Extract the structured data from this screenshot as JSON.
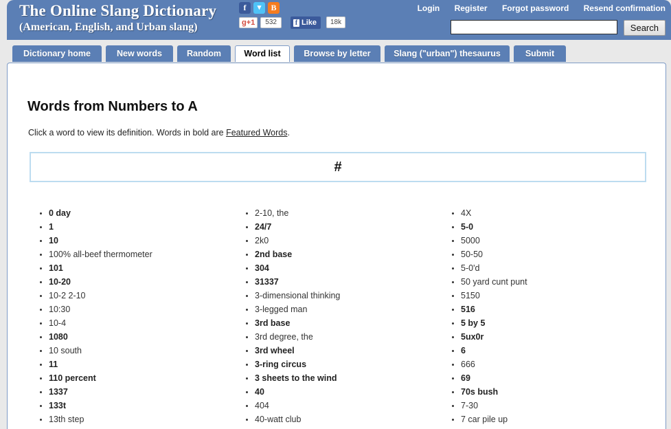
{
  "header": {
    "title_line1": "The Online Slang Dictionary",
    "title_line2": "(American, English, and Urban slang)",
    "social": {
      "facebook_icon": "f",
      "twitter_icon": "▾",
      "blogger_icon": "B",
      "gplus_label": "g+1",
      "gplus_count": "532",
      "fb_like_label": "Like",
      "fb_like_count": "18k"
    },
    "account_links": [
      {
        "label": "Login"
      },
      {
        "label": "Register"
      },
      {
        "label": "Forgot password"
      },
      {
        "label": "Resend confirmation"
      }
    ],
    "search": {
      "value": "",
      "placeholder": "",
      "button_label": "Search"
    }
  },
  "tabs": [
    {
      "label": "Dictionary home",
      "active": false
    },
    {
      "label": "New words",
      "active": false
    },
    {
      "label": "Random",
      "active": false
    },
    {
      "label": "Word list",
      "active": true
    },
    {
      "label": "Browse by letter",
      "active": false
    },
    {
      "label": "Slang (\"urban\") thesaurus",
      "active": false
    },
    {
      "label": "Submit",
      "active": false
    }
  ],
  "main": {
    "page_title": "Words from Numbers to A",
    "subtitle_prefix": "Click a word to view its definition. Words in bold are ",
    "subtitle_link": "Featured Words",
    "subtitle_suffix": ".",
    "letter_heading": "#",
    "columns": [
      {
        "items": [
          {
            "label": "0 day",
            "featured": true
          },
          {
            "label": "1",
            "featured": true
          },
          {
            "label": "10",
            "featured": true
          },
          {
            "label": "100% all-beef thermometer",
            "featured": false
          },
          {
            "label": "101",
            "featured": true
          },
          {
            "label": "10-20",
            "featured": true
          },
          {
            "label": "10-2 2-10",
            "featured": false
          },
          {
            "label": "10:30",
            "featured": false
          },
          {
            "label": "10-4",
            "featured": false
          },
          {
            "label": "1080",
            "featured": true
          },
          {
            "label": "10 south",
            "featured": false
          },
          {
            "label": "11",
            "featured": true
          },
          {
            "label": "110 percent",
            "featured": true
          },
          {
            "label": "1337",
            "featured": true
          },
          {
            "label": "133t",
            "featured": true
          },
          {
            "label": "13th step",
            "featured": false
          }
        ]
      },
      {
        "items": [
          {
            "label": "2-10, the",
            "featured": false
          },
          {
            "label": "24/7",
            "featured": true
          },
          {
            "label": "2k0",
            "featured": false
          },
          {
            "label": "2nd base",
            "featured": true
          },
          {
            "label": "304",
            "featured": true
          },
          {
            "label": "31337",
            "featured": true
          },
          {
            "label": "3-dimensional thinking",
            "featured": false
          },
          {
            "label": "3-legged man",
            "featured": false
          },
          {
            "label": "3rd base",
            "featured": true
          },
          {
            "label": "3rd degree, the",
            "featured": false
          },
          {
            "label": "3rd wheel",
            "featured": true
          },
          {
            "label": "3-ring circus",
            "featured": true
          },
          {
            "label": "3 sheets to the wind",
            "featured": true
          },
          {
            "label": "40",
            "featured": true
          },
          {
            "label": "404",
            "featured": false
          },
          {
            "label": "40-watt club",
            "featured": false
          }
        ]
      },
      {
        "items": [
          {
            "label": "4X",
            "featured": false
          },
          {
            "label": "5-0",
            "featured": true
          },
          {
            "label": "5000",
            "featured": false
          },
          {
            "label": "50-50",
            "featured": false
          },
          {
            "label": "5-0'd",
            "featured": false
          },
          {
            "label": "50 yard cunt punt",
            "featured": false
          },
          {
            "label": "5150",
            "featured": false
          },
          {
            "label": "516",
            "featured": true
          },
          {
            "label": "5 by 5",
            "featured": true
          },
          {
            "label": "5ux0r",
            "featured": true
          },
          {
            "label": "6",
            "featured": true
          },
          {
            "label": "666",
            "featured": false
          },
          {
            "label": "69",
            "featured": true
          },
          {
            "label": "70s bush",
            "featured": true
          },
          {
            "label": "7-30",
            "featured": false
          },
          {
            "label": "7 car pile up",
            "featured": false
          }
        ]
      }
    ]
  },
  "colors": {
    "header_blue": "#5b7fb5",
    "page_bg": "#e9e9e9",
    "panel_border": "#7e9bc6",
    "letterbox_border": "#bcdcf0"
  }
}
